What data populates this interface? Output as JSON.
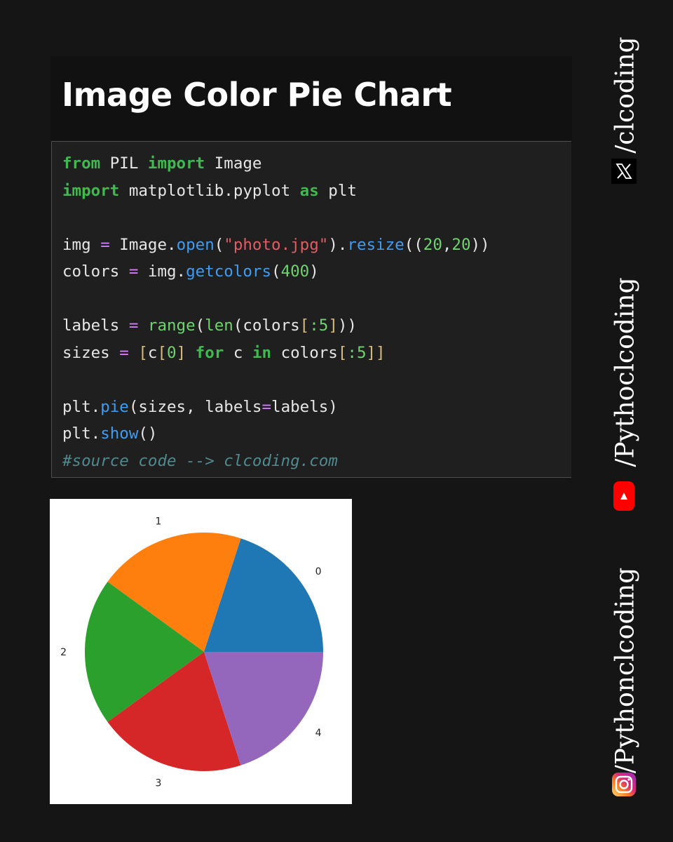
{
  "header": {
    "title": "Image Color Pie Chart"
  },
  "code": {
    "line1": {
      "kw1": "from",
      "mod": " PIL ",
      "kw2": "import",
      "name": " Image"
    },
    "line2": {
      "kw1": "import",
      "mod": " matplotlib.pyplot ",
      "kw2": "as",
      "name": " plt"
    },
    "line3": {
      "var": "img ",
      "eq": "=",
      "obj": " Image.",
      "fn1": "open",
      "p1": "(",
      "str": "\"photo.jpg\"",
      "p2": ").",
      "fn2": "resize",
      "p3": "((",
      "n1": "20",
      "comma": ",",
      "n2": "20",
      "p4": "))"
    },
    "line4": {
      "var": "colors ",
      "eq": "=",
      "obj": " img.",
      "fn": "getcolors",
      "p1": "(",
      "n": "400",
      "p2": ")"
    },
    "line5": {
      "var": "labels ",
      "eq": "=",
      "sp": " ",
      "fn1": "range",
      "p1": "(",
      "fn2": "len",
      "p2": "(colors",
      "b1": "[",
      "s1": ":",
      "n": "5",
      "b2": "]",
      "p3": "))"
    },
    "line6": {
      "var": "sizes ",
      "eq": "=",
      "sp": " ",
      "b1": "[",
      "c": "c",
      "b2": "[",
      "n0": "0",
      "b3": "]",
      "sp2": " ",
      "kw1": "for",
      "mid": " c ",
      "kw2": "in",
      "col": " colors",
      "b4": "[",
      "s1": ":",
      "n5": "5",
      "b5": "]]"
    },
    "line7": {
      "obj": "plt.",
      "fn": "pie",
      "p1": "(sizes, labels",
      "eq": "=",
      "p2": "labels)"
    },
    "line8": {
      "obj": "plt.",
      "fn": "show",
      "p": "()"
    },
    "line9": {
      "comment": "#source code --> clcoding.com"
    }
  },
  "chart_data": {
    "type": "pie",
    "categories": [
      "0",
      "1",
      "2",
      "3",
      "4"
    ],
    "values": [
      20,
      20,
      20,
      20,
      20
    ],
    "colors": [
      "#1f77b4",
      "#ff7f0e",
      "#2ca02c",
      "#d62728",
      "#9467bd"
    ],
    "start_angle_deg": 0,
    "direction": "counterclockwise"
  },
  "sidebar": {
    "twitter_handle": "/clcoding",
    "youtube_handle": "/Pythoclcoding",
    "instagram_handle": "/Pythonclcoding",
    "icons": {
      "twitter": "x-logo-icon",
      "youtube": "youtube-logo-icon",
      "instagram": "instagram-logo-icon"
    },
    "colors": {
      "youtube": "#ff0000",
      "instagram_start": "#feda75",
      "instagram_end": "#962fbf"
    }
  }
}
